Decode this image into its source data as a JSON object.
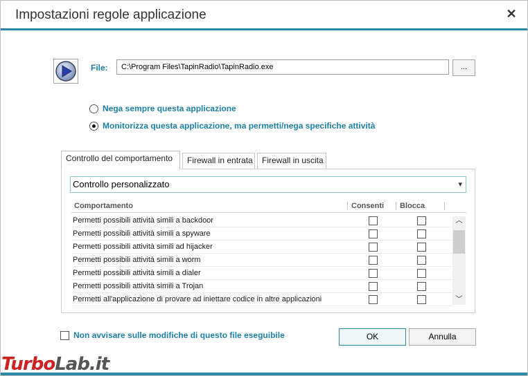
{
  "window": {
    "title": "Impostazioni regole applicazione",
    "close_label": "✕"
  },
  "file": {
    "label": "File:",
    "value": "C:\\Program Files\\TapinRadio\\TapinRadio.exe",
    "browse_label": "..."
  },
  "options": [
    {
      "label": "Nega sempre questa applicazione",
      "selected": false
    },
    {
      "label": "Monitorizza questa applicazione, ma permetti/nega specifiche attività",
      "selected": true
    }
  ],
  "tabs": [
    {
      "label": "Controllo del comportamento",
      "active": true
    },
    {
      "label": "Firewall in entrata",
      "active": false
    },
    {
      "label": "Firewall in uscita",
      "active": false
    }
  ],
  "behavior_select": {
    "value": "Controllo personalizzato"
  },
  "grid": {
    "columns": [
      "Comportamento",
      "Consenti",
      "Blocca"
    ],
    "rows": [
      {
        "label": "Permetti possibili attività simili a backdoor",
        "consenti": false,
        "blocca": false
      },
      {
        "label": "Permetti possibili attività simili a spyware",
        "consenti": false,
        "blocca": false
      },
      {
        "label": "Permetti possibili attività simili ad hijacker",
        "consenti": false,
        "blocca": false
      },
      {
        "label": "Permetti possibili attività simili a worm",
        "consenti": false,
        "blocca": false
      },
      {
        "label": "Permetti possibili attività simili a dialer",
        "consenti": false,
        "blocca": false
      },
      {
        "label": "Permetti possibili attività simili a Trojan",
        "consenti": false,
        "blocca": false
      },
      {
        "label": "Permetti all'applicazione di provare ad iniettare codice in altre applicazioni",
        "consenti": false,
        "blocca": false
      }
    ]
  },
  "notify": {
    "label": "Non avvisare sulle modifiche di questo file eseguibile",
    "checked": false
  },
  "buttons": {
    "ok": "OK",
    "cancel": "Annulla"
  },
  "watermark": {
    "part1": "Turbo",
    "part2": "Lab.it"
  },
  "colors": {
    "accent": "#2c86a8",
    "label_blue": "#1c7fa4"
  }
}
